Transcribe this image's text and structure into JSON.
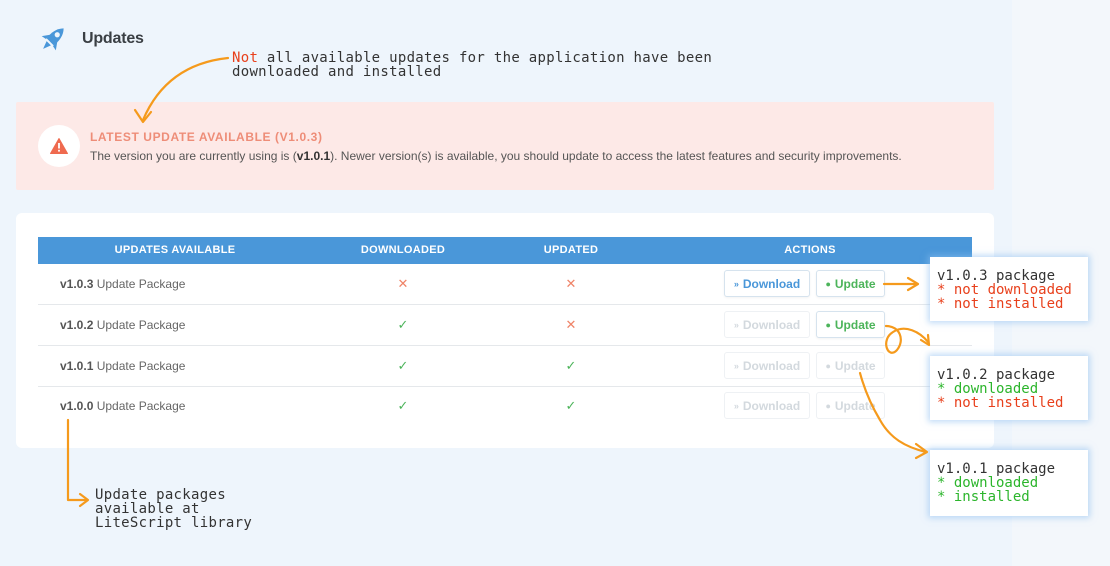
{
  "page": {
    "title": "Updates",
    "icon": "rocket-icon"
  },
  "annotations": {
    "top_note": {
      "highlight": "Not",
      "line1_rest": "all available updates for the application have been",
      "line2": "downloaded and installed"
    },
    "bottom_note": {
      "line1": "Update packages",
      "line2": "available at",
      "line3": "LiteScript library"
    },
    "callouts": [
      {
        "title": "v1.0.3 package",
        "line1": "* not downloaded",
        "line2": "* not installed"
      },
      {
        "title": "v1.0.2 package",
        "line1": "* downloaded",
        "line2": "* not installed"
      },
      {
        "title": "v1.0.1 package",
        "line1": "* downloaded",
        "line2": "* installed"
      }
    ]
  },
  "alert": {
    "icon": "warning-triangle-icon",
    "title": "LATEST UPDATE AVAILABLE (V1.0.3)",
    "desc_prefix": "The version you are currently using is (",
    "current_version": "v1.0.1",
    "desc_suffix": "). Newer version(s) is available, you should update to access the latest features and security improvements."
  },
  "table": {
    "headers": [
      "UPDATES AVAILABLE",
      "DOWNLOADED",
      "UPDATED",
      "ACTIONS"
    ],
    "rows": [
      {
        "version": "v1.0.3",
        "label": "Update Package",
        "downloaded": "✕",
        "updated": "✕"
      },
      {
        "version": "v1.0.2",
        "label": "Update Package",
        "downloaded": "✓",
        "updated": "✕"
      },
      {
        "version": "v1.0.1",
        "label": "Update Package",
        "downloaded": "✓",
        "updated": "✓"
      },
      {
        "version": "v1.0.0",
        "label": "Update Package",
        "downloaded": "✓",
        "updated": "✓"
      }
    ],
    "download_label": "Download",
    "update_label": "Update"
  },
  "colors": {
    "accent": "#4a97d9",
    "annotation_arrow": "#f59a1c",
    "alert_bg": "#fde9e7",
    "alert_title": "#ee8d78",
    "success": "#4cb45a",
    "error": "#ef8367"
  }
}
